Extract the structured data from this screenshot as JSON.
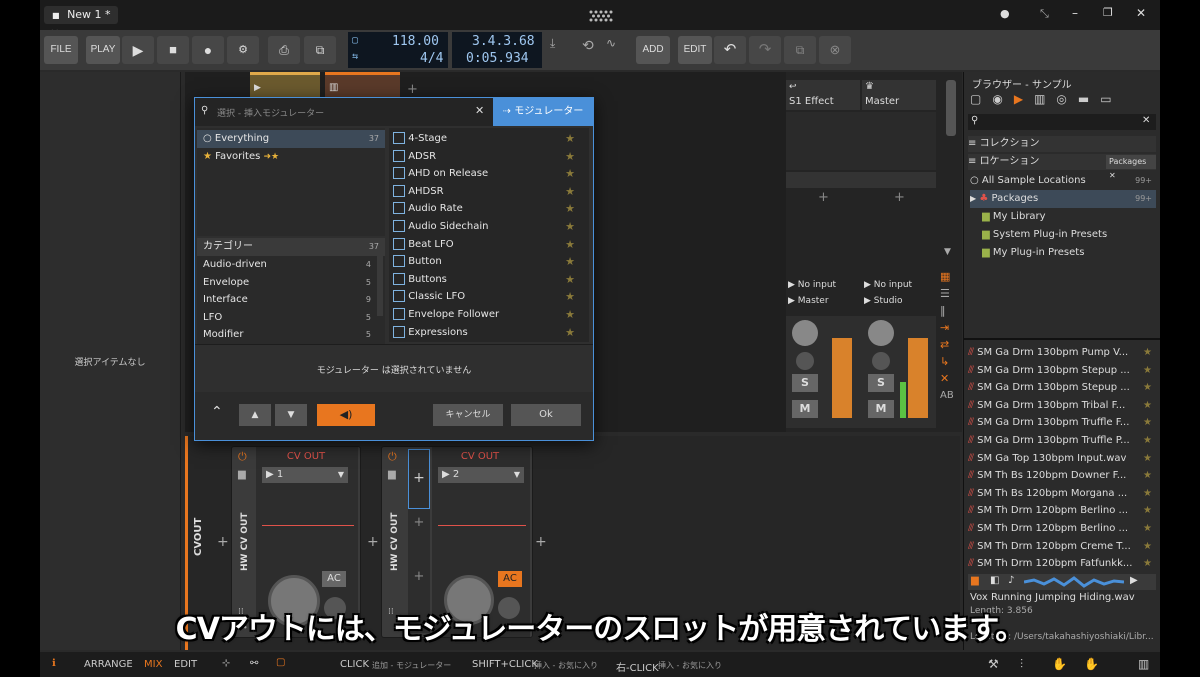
{
  "window": {
    "tab_title": "New 1 *",
    "tab_close": "✕"
  },
  "window_controls": {
    "dot": "●",
    "min": "–",
    "max": "❐",
    "close": "✕"
  },
  "toolbar": {
    "file": "FILE",
    "play_mode": "PLAY",
    "tempo": "118.00",
    "time_sig": "4/4",
    "position": "3.4.3.68",
    "time": "0:05.934",
    "add": "ADD",
    "edit": "EDIT"
  },
  "inspector": {
    "empty_text": "選択アイテムなし"
  },
  "modal": {
    "search_placeholder": "選択 - 挿入モジュレーター",
    "title_tab": "モジュレーター",
    "filters": [
      {
        "label": "Everything",
        "count": "37"
      },
      {
        "label": "Favorites",
        "count": ""
      }
    ],
    "category_header": {
      "label": "カテゴリー",
      "count": "37"
    },
    "categories": [
      {
        "label": "Audio-driven",
        "count": "4"
      },
      {
        "label": "Envelope",
        "count": "5"
      },
      {
        "label": "Interface",
        "count": "9"
      },
      {
        "label": "LFO",
        "count": "5"
      },
      {
        "label": "Modifier",
        "count": "5"
      }
    ],
    "modulators": [
      "4-Stage",
      "ADSR",
      "AHD on Release",
      "AHDSR",
      "Audio Rate",
      "Audio Sidechain",
      "Beat LFO",
      "Button",
      "Buttons",
      "Classic LFO",
      "Envelope Follower",
      "Expressions"
    ],
    "empty_message": "モジュレーター は選択されていません",
    "cancel": "キャンセル",
    "ok": "Ok"
  },
  "mixer": {
    "channels": [
      {
        "name": "S1 Effect",
        "input": "No input",
        "output": "Master"
      },
      {
        "name": "Master",
        "input": "No input",
        "output": "Studio"
      }
    ],
    "solo": "S",
    "mute": "M"
  },
  "browser": {
    "title": "ブラウザー - サンプル",
    "collection": "コレクション",
    "location": "ロケーション",
    "packages_chip": "Packages",
    "locations": [
      {
        "label": "All Sample Locations",
        "count": "99+"
      },
      {
        "label": "Packages",
        "count": "99+"
      },
      {
        "label": "My Library",
        "count": ""
      },
      {
        "label": "System Plug-in Presets",
        "count": ""
      },
      {
        "label": "My Plug-in Presets",
        "count": ""
      }
    ],
    "files": [
      "SM Ga Drm 130bpm Pump V...",
      "SM Ga Drm 130bpm Stepup ...",
      "SM Ga Drm 130bpm Stepup ...",
      "SM Ga Drm 130bpm Tribal F...",
      "SM Ga Drm 130bpm Truffle F...",
      "SM Ga Drm 130bpm Truffle P...",
      "SM Ga Top 130bpm Input.wav",
      "SM Th Bs 120bpm Downer F...",
      "SM Th Bs 120bpm Morgana ...",
      "SM Th Drm 120bpm Berlino ...",
      "SM Th Drm 120bpm Berlino ...",
      "SM Th Drm 120bpm Creme T...",
      "SM Th Drm 120bpm Fatfunkk..."
    ],
    "preview_name": "Vox Running Jumping Hiding.wav",
    "preview_length": "Length: 3.856",
    "preview_location": "Location: /Users/takahashiyoshiaki/Libr..."
  },
  "devices": {
    "chain_label": "CVOUT",
    "device1": {
      "title": "CV OUT",
      "vertical_name": "HW CV OUT",
      "channel": "1",
      "ac": "AC"
    },
    "device2": {
      "title": "CV OUT",
      "vertical_name": "HW CV OUT",
      "channel": "2",
      "ac": "AC"
    }
  },
  "statusbar": {
    "arrange": "ARRANGE",
    "mix": "MIX",
    "edit": "EDIT",
    "click": "CLICK",
    "click_desc": "追加 - モジュレーター",
    "shift_click": "SHIFT+CLICK",
    "shift_desc": "挿入 - お気に入り",
    "right_click": "右-CLICK",
    "right_desc": "挿入 - お気に入り"
  },
  "subtitle": "CVアウトには、モジュレーターのスロットが用意されています。",
  "colors": {
    "accent_orange": "#e8761f",
    "accent_blue": "#4a90d9",
    "cv_red": "#e0524a"
  }
}
